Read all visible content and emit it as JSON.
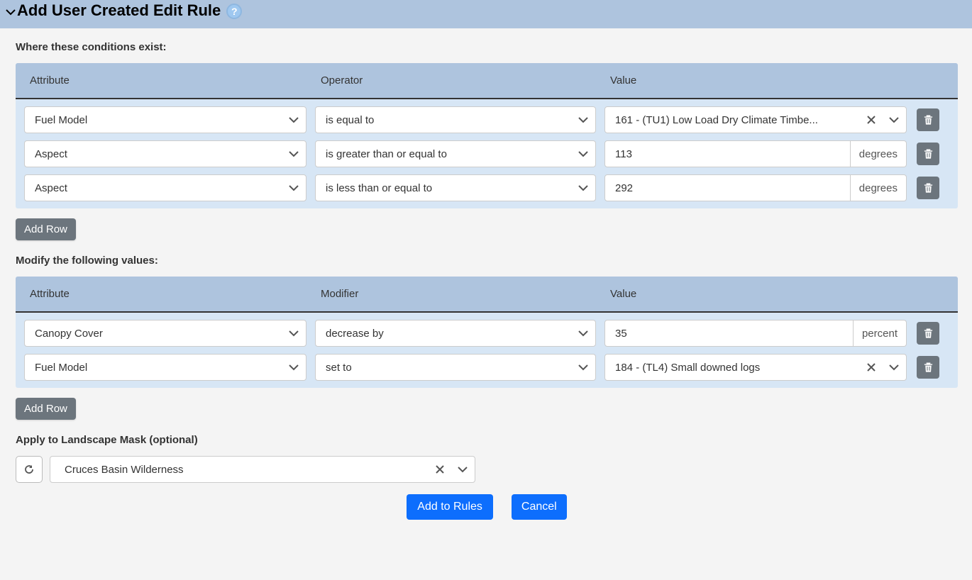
{
  "header": {
    "title": "Add User Created Edit Rule"
  },
  "conditions": {
    "label": "Where these conditions exist:",
    "columns": {
      "attribute": "Attribute",
      "operator": "Operator",
      "value": "Value"
    },
    "rows": [
      {
        "attribute": "Fuel Model",
        "operator": "is equal to",
        "value": "161 - (TU1) Low Load Dry Climate Timbe...",
        "value_type": "combo"
      },
      {
        "attribute": "Aspect",
        "operator": "is greater than or equal to",
        "value": "113",
        "unit": "degrees",
        "value_type": "text"
      },
      {
        "attribute": "Aspect",
        "operator": "is less than or equal to",
        "value": "292",
        "unit": "degrees",
        "value_type": "text"
      }
    ],
    "add_row_label": "Add Row"
  },
  "modifiers": {
    "label": "Modify the following values:",
    "columns": {
      "attribute": "Attribute",
      "modifier": "Modifier",
      "value": "Value"
    },
    "rows": [
      {
        "attribute": "Canopy Cover",
        "modifier": "decrease by",
        "value": "35",
        "unit": "percent",
        "value_type": "text"
      },
      {
        "attribute": "Fuel Model",
        "modifier": "set to",
        "value": "184 - (TL4) Small downed logs",
        "value_type": "combo"
      }
    ],
    "add_row_label": "Add Row"
  },
  "mask": {
    "label": "Apply to Landscape Mask (optional)",
    "value": "Cruces Basin Wilderness"
  },
  "footer": {
    "add_label": "Add to Rules",
    "cancel_label": "Cancel"
  }
}
